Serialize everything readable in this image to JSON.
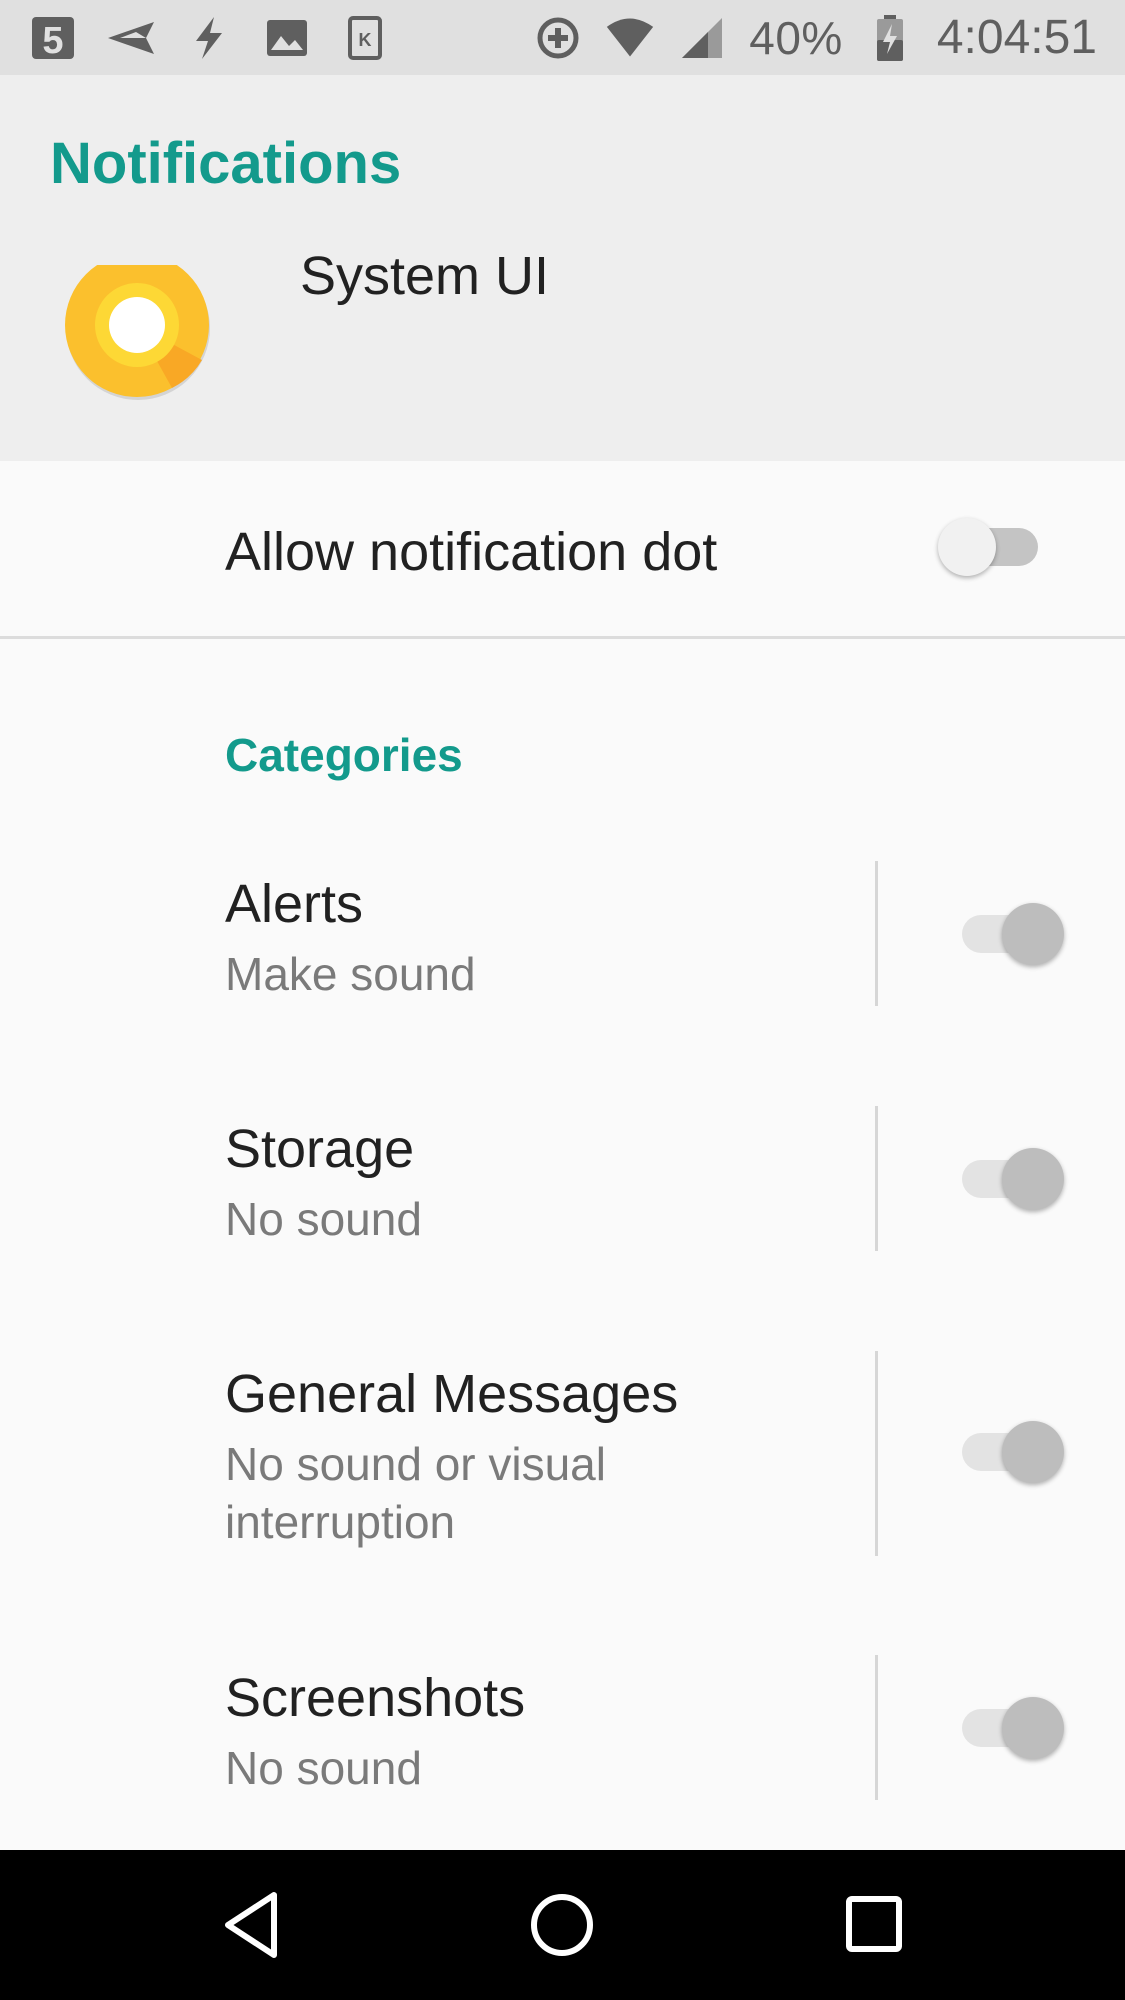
{
  "status_bar": {
    "icons_left": [
      "channel-5-icon",
      "send-icon",
      "flash-icon",
      "image-icon",
      "k-app-icon"
    ],
    "icons_right": [
      "data-saver-icon",
      "wifi-icon",
      "cell-signal-icon",
      "battery-icon"
    ],
    "battery_percent": "40%",
    "time": "4:04:51"
  },
  "header": {
    "title": "Notifications",
    "app_name": "System UI",
    "accent_color": "#139a8c"
  },
  "allow_dot": {
    "label": "Allow notification dot",
    "enabled": false
  },
  "categories": {
    "header": "Categories",
    "items": [
      {
        "title": "Alerts",
        "subtitle": "Make sound",
        "enabled": true
      },
      {
        "title": "Storage",
        "subtitle": "No sound",
        "enabled": true
      },
      {
        "title": "General Messages",
        "subtitle": "No sound or visual interruption",
        "enabled": true
      },
      {
        "title": "Screenshots",
        "subtitle": "No sound",
        "enabled": true
      }
    ]
  },
  "nav_bar": {
    "buttons": [
      "back-icon",
      "home-icon",
      "recents-icon"
    ]
  }
}
